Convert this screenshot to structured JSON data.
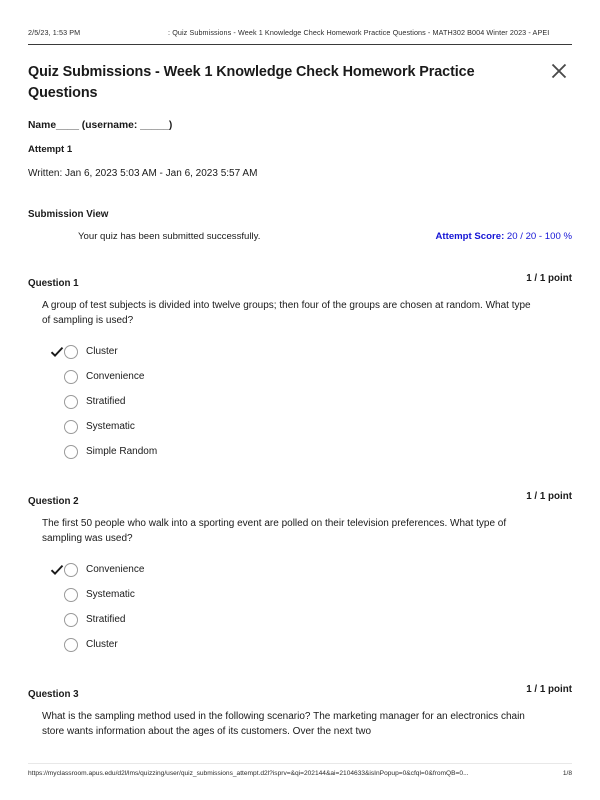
{
  "print_header": {
    "date": "2/5/23, 1:53 PM",
    "title": ": Quiz Submissions - Week 1 Knowledge Check Homework Practice Questions - MATH302 B004 Winter 2023 - APEI"
  },
  "document": {
    "title": "Quiz Submissions - Week 1 Knowledge Check Homework Practice Questions",
    "close_label": "close-icon",
    "user_line": "Name____ (username: _____)",
    "attempt_label": "Attempt 1",
    "written_line": "Written: Jan 6, 2023 5:03 AM - Jan 6, 2023 5:57 AM"
  },
  "submission": {
    "heading": "Submission  View",
    "message": "Your quiz has been submitted successfully.",
    "score_label": "Attempt Score:",
    "score_value": " 20 / 20 - 100 %",
    "score_color": "#1414d6"
  },
  "questions": [
    {
      "number": "Question 1",
      "points": "1 / 1 point",
      "text": "A group of test subjects is divided into twelve groups; then four of the groups are chosen at random. What type of sampling is used?",
      "options": [
        {
          "label": "Cluster",
          "selected": true
        },
        {
          "label": "Convenience",
          "selected": false
        },
        {
          "label": "Stratified",
          "selected": false
        },
        {
          "label": "Systematic",
          "selected": false
        },
        {
          "label": "Simple Random",
          "selected": false
        }
      ]
    },
    {
      "number": "Question 2",
      "points": "1 / 1 point",
      "text": "The first 50 people who walk into a sporting event are polled on their television preferences. What type of sampling was used?",
      "options": [
        {
          "label": "Convenience",
          "selected": true
        },
        {
          "label": "Systematic",
          "selected": false
        },
        {
          "label": "Stratified",
          "selected": false
        },
        {
          "label": "Cluster",
          "selected": false
        }
      ]
    },
    {
      "number": "Question 3",
      "points": "1 / 1 point",
      "text": "What is the sampling method used in the following scenario? The marketing manager for an electronics chain store wants information about the ages of its customers. Over the next two",
      "options": []
    }
  ],
  "print_footer": {
    "url": "https://myclassroom.apus.edu/d2l/lms/quizzing/user/quiz_submissions_attempt.d2l?isprv=&qi=202144&ai=2104633&isInPopup=0&cfql=0&fromQB=0...",
    "page": "1/8"
  }
}
